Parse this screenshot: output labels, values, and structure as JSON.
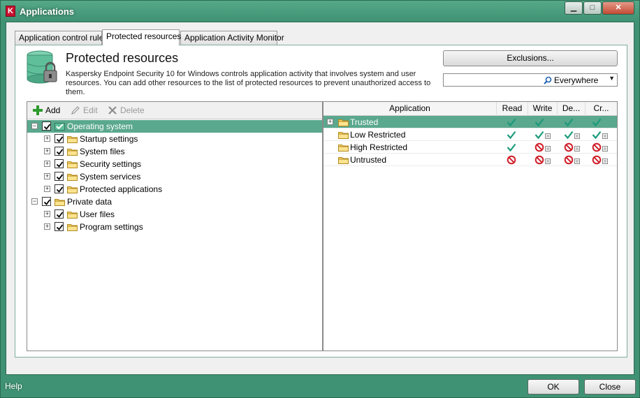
{
  "window": {
    "title": "Applications",
    "app_icon_letter": "K",
    "minimize_glyph": "▁",
    "maximize_glyph": "□",
    "close_glyph": "✕"
  },
  "tabs": [
    {
      "label": "Application control rules",
      "active": false
    },
    {
      "label": "Protected resources",
      "active": true
    },
    {
      "label": "Application Activity Monitor",
      "active": false
    }
  ],
  "header": {
    "title": "Protected resources",
    "description": "Kaspersky Endpoint Security 10 for Windows controls application activity that involves system and user resources. You can add other resources to the list of protected resources to prevent unauthorized access to them."
  },
  "exclusions_button": "Exclusions...",
  "scope": {
    "selected": "Everywhere",
    "icon": "search-icon"
  },
  "toolbar": {
    "add": {
      "label": "Add",
      "enabled": true,
      "icon": "plus-icon"
    },
    "edit": {
      "label": "Edit",
      "enabled": false,
      "icon": "pencil-icon"
    },
    "delete": {
      "label": "Delete",
      "enabled": false,
      "icon": "delete-icon"
    }
  },
  "tree": [
    {
      "label": "Operating system",
      "level": 0,
      "expanded": true,
      "checked": true,
      "selected": true,
      "icon": "os-icon"
    },
    {
      "label": "Startup settings",
      "level": 1,
      "expanded": false,
      "checked": true,
      "icon": "folder-icon"
    },
    {
      "label": "System files",
      "level": 1,
      "expanded": false,
      "checked": true,
      "icon": "folder-icon"
    },
    {
      "label": "Security settings",
      "level": 1,
      "expanded": false,
      "checked": true,
      "icon": "folder-icon"
    },
    {
      "label": "System services",
      "level": 1,
      "expanded": false,
      "checked": true,
      "icon": "folder-icon"
    },
    {
      "label": "Protected applications",
      "level": 1,
      "expanded": false,
      "checked": true,
      "icon": "folder-icon"
    },
    {
      "label": "Private data",
      "level": 0,
      "expanded": true,
      "checked": true,
      "icon": "folder-icon"
    },
    {
      "label": "User files",
      "level": 1,
      "expanded": false,
      "checked": true,
      "icon": "folder-icon"
    },
    {
      "label": "Program settings",
      "level": 1,
      "expanded": false,
      "checked": true,
      "icon": "folder-icon"
    }
  ],
  "grid": {
    "columns": [
      "Application",
      "Read",
      "Write",
      "De...",
      "Cr..."
    ],
    "rows": [
      {
        "label": "Trusted",
        "expandable": true,
        "selected": true,
        "read": "allow",
        "write": "allow",
        "delete": "allow",
        "create": "allow",
        "logged": [
          false,
          false,
          false,
          false
        ]
      },
      {
        "label": "Low Restricted",
        "expandable": false,
        "selected": false,
        "read": "allow",
        "write": "allow",
        "delete": "allow",
        "create": "allow",
        "logged": [
          false,
          true,
          true,
          true
        ]
      },
      {
        "label": "High Restricted",
        "expandable": false,
        "selected": false,
        "read": "allow",
        "write": "deny",
        "delete": "deny",
        "create": "deny",
        "logged": [
          false,
          true,
          true,
          true
        ]
      },
      {
        "label": "Untrusted",
        "expandable": false,
        "selected": false,
        "read": "deny",
        "write": "deny",
        "delete": "deny",
        "create": "deny",
        "logged": [
          false,
          true,
          true,
          true
        ]
      }
    ]
  },
  "footer": {
    "help": "Help",
    "ok": "OK",
    "close": "Close"
  },
  "colors": {
    "frame": "#3f9273",
    "selection": "#5aa88d",
    "allow": "#1a9a7a",
    "deny": "#d0202a"
  }
}
